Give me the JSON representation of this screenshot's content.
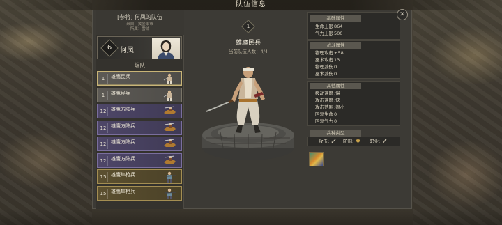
{
  "window": {
    "title": "队伍信息"
  },
  "team": {
    "name": "[参将] 何凤的队伍",
    "origin_label": "来自：",
    "origin": "黄金集市",
    "affiliation_label": "所属：",
    "affiliation": "雪绒"
  },
  "leader": {
    "level": "6",
    "name": "何凤"
  },
  "formation": {
    "title": "编队",
    "units": [
      {
        "badge": "1",
        "name": "雄鹰民兵",
        "style": "gray",
        "selected": true,
        "icon": "swordsman-icon"
      },
      {
        "badge": "1",
        "name": "雄鹰民兵",
        "style": "gray",
        "selected": false,
        "icon": "swordsman-icon"
      },
      {
        "badge": "12",
        "name": "雄鹰方阵兵",
        "style": "purple",
        "selected": false,
        "icon": "cavalry-icon"
      },
      {
        "badge": "12",
        "name": "雄鹰方阵兵",
        "style": "purple",
        "selected": false,
        "icon": "cavalry-icon"
      },
      {
        "badge": "12",
        "name": "雄鹰方阵兵",
        "style": "purple",
        "selected": false,
        "icon": "cavalry-icon"
      },
      {
        "badge": "12",
        "name": "雄鹰方阵兵",
        "style": "purple",
        "selected": false,
        "icon": "cavalry-icon"
      },
      {
        "badge": "15",
        "name": "雄鹰隼枪兵",
        "style": "gold",
        "selected": false,
        "icon": "gunner-icon"
      },
      {
        "badge": "15",
        "name": "雄鹰隼枪兵",
        "style": "gold",
        "selected": false,
        "icon": "gunner-icon"
      }
    ]
  },
  "selected_unit": {
    "level": "1",
    "name": "雄鹰民兵",
    "count_label": "当前队伍人数：",
    "count": "4/4"
  },
  "stats": {
    "base": {
      "header": "基础属性",
      "items": [
        {
          "label": "生命上限",
          "value": "864"
        },
        {
          "label": "气力上限",
          "value": "500"
        }
      ]
    },
    "combat": {
      "header": "战斗属性",
      "items": [
        {
          "label": "物理攻击",
          "value": "+58"
        },
        {
          "label": "巫术攻击",
          "value": "13"
        },
        {
          "label": "物理减伤",
          "value": "0"
        },
        {
          "label": "巫术减伤",
          "value": "0"
        }
      ]
    },
    "other": {
      "header": "其他属性",
      "items": [
        {
          "label": "移动速度",
          "value": ":慢"
        },
        {
          "label": "攻击速度",
          "value": ":快"
        },
        {
          "label": "攻击范围",
          "value": ":很小"
        },
        {
          "label": "回复生命",
          "value": "0"
        },
        {
          "label": "回复气力",
          "value": "0"
        }
      ]
    },
    "type": {
      "header": "兵种类型",
      "attack_label": "攻击:",
      "attack_icon": "sword-icon",
      "defense_label": "防御:",
      "defense_icon": "shield-icon",
      "class_label": "职业:",
      "class_icon": "staff-icon"
    }
  },
  "colors": {
    "panel": "#3c3a35",
    "gray_row": "#5d5a55",
    "purple_row": "#4e4668",
    "gold_row": "#5c5030",
    "selected_border": "#c8b477"
  }
}
